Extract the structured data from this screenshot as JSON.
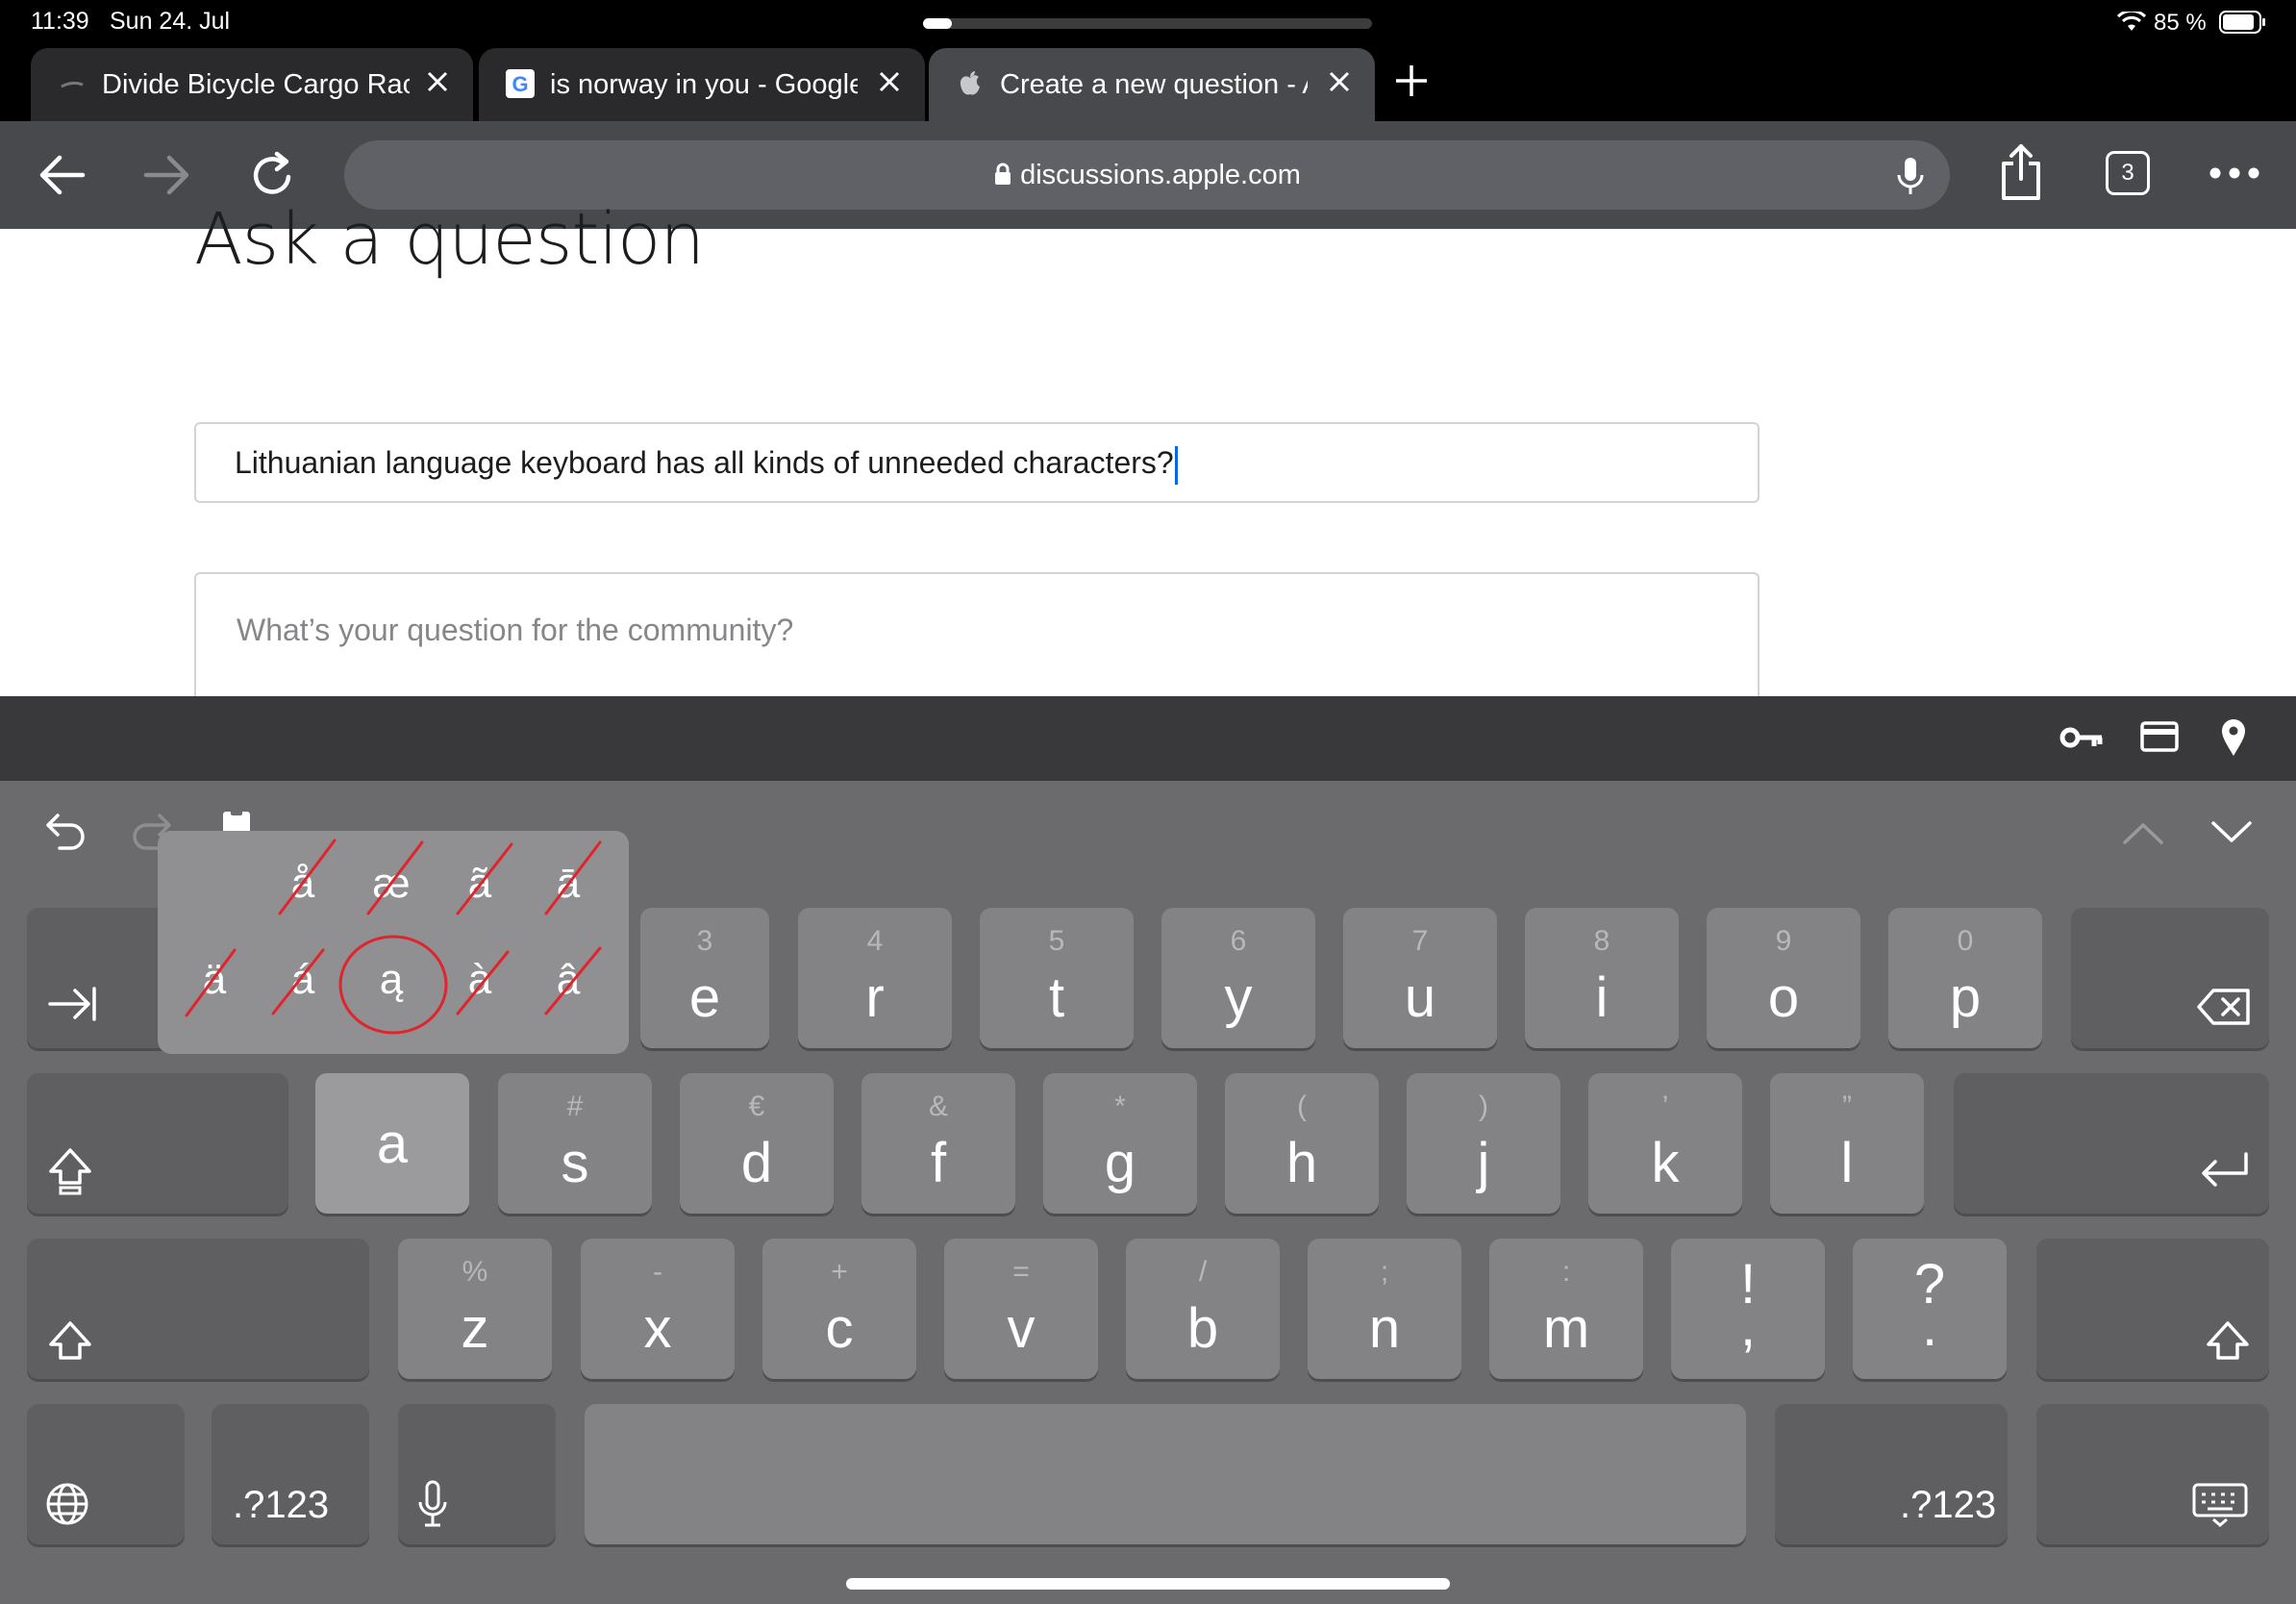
{
  "status": {
    "time": "11:39",
    "date": "Sun 24. Jul",
    "battery": "85 %"
  },
  "tabs": [
    {
      "title": "Divide Bicycle Cargo Rac",
      "icon": "bike-favicon-icon"
    },
    {
      "title": "is norway in you - Google",
      "icon": "google-favicon-icon"
    },
    {
      "title": "Create a new question - A",
      "icon": "apple-favicon-icon",
      "active": true
    }
  ],
  "url": "discussions.apple.com",
  "tab_count": "3",
  "page": {
    "heading": "Ask a question",
    "title_value": "Lithuanian language keyboard has all kinds of unneeded characters?",
    "question_placeholder": "What’s your question for the community?"
  },
  "keyboard": {
    "row1": [
      {
        "main": "e",
        "sub": "3"
      },
      {
        "main": "r",
        "sub": "4"
      },
      {
        "main": "t",
        "sub": "5"
      },
      {
        "main": "y",
        "sub": "6"
      },
      {
        "main": "u",
        "sub": "7"
      },
      {
        "main": "i",
        "sub": "8"
      },
      {
        "main": "o",
        "sub": "9"
      },
      {
        "main": "p",
        "sub": "0"
      }
    ],
    "row2": [
      {
        "main": "a",
        "sub": ""
      },
      {
        "main": "s",
        "sub": "#"
      },
      {
        "main": "d",
        "sub": "€"
      },
      {
        "main": "f",
        "sub": "&"
      },
      {
        "main": "g",
        "sub": "*"
      },
      {
        "main": "h",
        "sub": "("
      },
      {
        "main": "j",
        "sub": ")"
      },
      {
        "main": "k",
        "sub": "’"
      },
      {
        "main": "l",
        "sub": "”"
      }
    ],
    "row3": [
      {
        "main": "z",
        "sub": "%"
      },
      {
        "main": "x",
        "sub": "-"
      },
      {
        "main": "c",
        "sub": "+"
      },
      {
        "main": "v",
        "sub": "="
      },
      {
        "main": "b",
        "sub": "/"
      },
      {
        "main": "n",
        "sub": ";"
      },
      {
        "main": "m",
        "sub": ":"
      },
      {
        "main": ",",
        "sub": "!"
      },
      {
        "main": ".",
        "sub": "?"
      }
    ],
    "numbers_label": ".?123",
    "popup_row1": [
      "å",
      "æ",
      "ã",
      "ā"
    ],
    "popup_row2": [
      "ä",
      "á",
      "ą",
      "à",
      "â"
    ],
    "annotation_color": "#e0242e"
  }
}
